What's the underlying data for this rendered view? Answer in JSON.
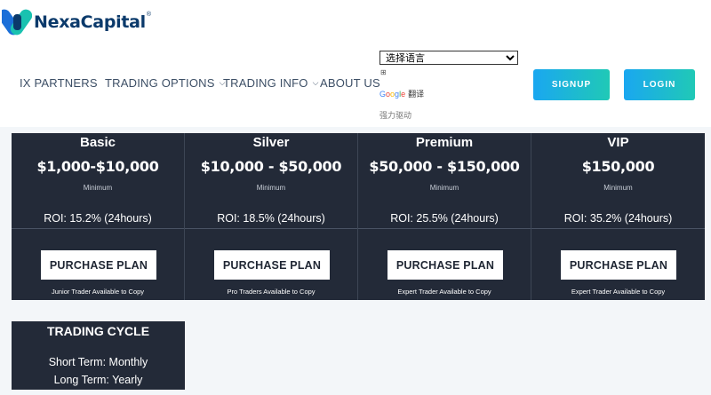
{
  "brand": {
    "name": "NexaCapital",
    "registered": "®",
    "colors": {
      "primary": "#0b3a6b",
      "accent": "#20c9b6"
    }
  },
  "nav": {
    "items": [
      {
        "label": "IX PARTNERS",
        "dropdown": false
      },
      {
        "label": "TRADING OPTIONS",
        "dropdown": true
      },
      {
        "label": "TRADING INFO",
        "dropdown": true
      },
      {
        "label": "ABOUT US",
        "dropdown": false
      }
    ],
    "chevron": "⌵"
  },
  "translate": {
    "select_value": "选择语言",
    "glyph": "⊞",
    "google_letters": [
      "G",
      "o",
      "o",
      "g",
      "l",
      "e"
    ],
    "label": "翻译",
    "powered_by": "强力驱动"
  },
  "auth": {
    "signup_label": "SIGNUP",
    "login_label": "LOGIN"
  },
  "plans": [
    {
      "name": "Basic",
      "price": "$1,000-$10,000",
      "min_label": "Minimum",
      "roi": "ROI: 15.2% (24hours)",
      "button": "PURCHASE PLAN",
      "note": "Junior Trader Available to Copy"
    },
    {
      "name": "Silver",
      "price": "$10,000 - $50,000",
      "min_label": "Minimum",
      "roi": "ROI: 18.5% (24hours)",
      "button": "PURCHASE PLAN",
      "note": "Pro Traders Available to Copy"
    },
    {
      "name": "Premium",
      "price": "$50,000 - $150,000",
      "min_label": "Minimum",
      "roi": "ROI: 25.5% (24hours)",
      "button": "PURCHASE PLAN",
      "note": "Expert Trader Available to Copy"
    },
    {
      "name": "VIP",
      "price": "$150,000",
      "min_label": "Minimum",
      "roi": "ROI: 35.2% (24hours)",
      "button": "PURCHASE PLAN",
      "note": "Expert Trader Available to Copy"
    }
  ],
  "cycle": {
    "title": "TRADING CYCLE",
    "short": "Short Term: Monthly",
    "long": "Long Term: Yearly"
  }
}
